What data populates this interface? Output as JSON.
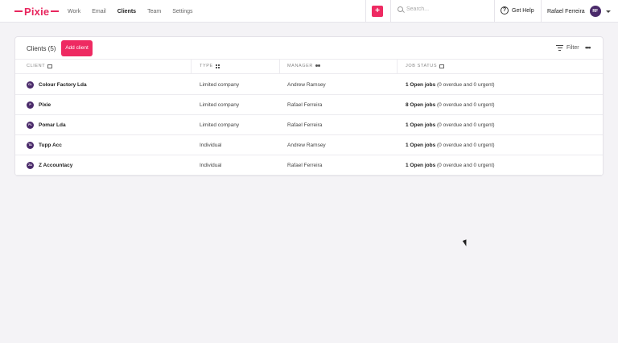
{
  "brand": {
    "name": "Pixie",
    "color": "#e8265e"
  },
  "nav": {
    "items": [
      {
        "label": "Work",
        "active": false
      },
      {
        "label": "Email",
        "active": false
      },
      {
        "label": "Clients",
        "active": true
      },
      {
        "label": "Team",
        "active": false
      },
      {
        "label": "Settings",
        "active": false
      }
    ]
  },
  "toolbar": {
    "add_icon": "plus-icon"
  },
  "search": {
    "placeholder": "Search..."
  },
  "help": {
    "label": "Get Help",
    "icon": "question-circle-icon"
  },
  "user": {
    "name": "Rafael Ferreira",
    "initials": "RF"
  },
  "clients_panel": {
    "title": "Clients (5)",
    "add_button": "Add client",
    "filter_label": "Filter",
    "more_icon": "more-horizontal-icon",
    "columns": [
      {
        "label": "CLIENT",
        "icon": "id-card-icon"
      },
      {
        "label": "TYPE",
        "icon": "grid-icon"
      },
      {
        "label": "MANAGER",
        "icon": "people-icon"
      },
      {
        "label": "JOB STATUS",
        "icon": "clipboard-icon"
      }
    ],
    "rows": [
      {
        "initials": "CL",
        "name": "Colour Factory Lda",
        "type": "Limited company",
        "manager": "Andrew Ramsey",
        "jobs_count": "1 Open jobs",
        "jobs_detail": "(0 overdue and 0 urgent)"
      },
      {
        "initials": "P",
        "name": "Pixie",
        "type": "Limited company",
        "manager": "Rafael Ferreira",
        "jobs_count": "8 Open jobs",
        "jobs_detail": "(0 overdue and 0 urgent)"
      },
      {
        "initials": "PL",
        "name": "Pomar Lda",
        "type": "Limited company",
        "manager": "Rafael Ferreira",
        "jobs_count": "1 Open jobs",
        "jobs_detail": "(0 overdue and 0 urgent)"
      },
      {
        "initials": "TA",
        "name": "Tupp Acc",
        "type": "Individual",
        "manager": "Andrew Ramsey",
        "jobs_count": "1 Open jobs",
        "jobs_detail": "(0 overdue and 0 urgent)"
      },
      {
        "initials": "ZA",
        "name": "Z Accountacy",
        "type": "Individual",
        "manager": "Rafael Ferreira",
        "jobs_count": "1 Open jobs",
        "jobs_detail": "(0 overdue and 0 urgent)"
      }
    ]
  }
}
